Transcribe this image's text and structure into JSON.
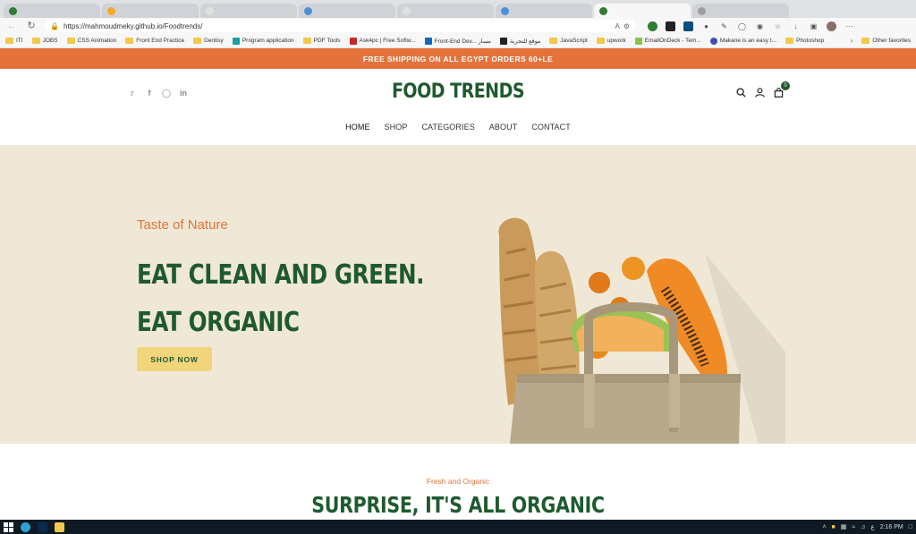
{
  "browser": {
    "tabs": [
      {
        "color": "#2e7d32"
      },
      {
        "color": "#f9a825"
      },
      {
        "color": "#e0e0e0"
      },
      {
        "color": "#4a90d9"
      },
      {
        "color": "#e0e0e0"
      },
      {
        "color": "#4a90d9"
      },
      {
        "color": "#2e7d32"
      },
      {
        "color": "#9e9e9e"
      }
    ],
    "url": "https://mahmoudmeky.github.io/Foodtrends/",
    "bookmarks": [
      {
        "label": "ITI",
        "kind": "folder"
      },
      {
        "label": "JOBS",
        "kind": "folder"
      },
      {
        "label": "CSS Animation",
        "kind": "folder"
      },
      {
        "label": "Front End Practice",
        "kind": "folder"
      },
      {
        "label": "Dentisy",
        "kind": "folder"
      },
      {
        "label": "Program application",
        "kind": "icon",
        "color": "#18a0a0"
      },
      {
        "label": "PDF Tools",
        "kind": "folder"
      },
      {
        "label": "Ask4pc | Free Softw...",
        "kind": "icon",
        "color": "#c62828"
      },
      {
        "label": "Front-End Dev... مسار",
        "kind": "icon",
        "color": "#1565c0"
      },
      {
        "label": "موقع للتجربة",
        "kind": "icon",
        "color": "#222222"
      },
      {
        "label": "JavaScript",
        "kind": "folder"
      },
      {
        "label": "upwork",
        "kind": "folder"
      },
      {
        "label": "EmailOnDeck - Tem...",
        "kind": "icon",
        "color": "#8bc34a"
      },
      {
        "label": "Makane is an easy t...",
        "kind": "icon",
        "color": "#3f51b5"
      },
      {
        "label": "Photoshop",
        "kind": "folder"
      }
    ],
    "other_favorites": "Other favorites"
  },
  "site": {
    "shipping_banner": "FREE SHIPPING ON ALL EGYPT ORDERS 60+LE",
    "logo": "FOOD TRENDS",
    "cart_count": "0",
    "nav": [
      "HOME",
      "SHOP",
      "CATEGORIES",
      "ABOUT",
      "CONTACT"
    ],
    "hero": {
      "tagline": "Taste of Nature",
      "title_line1": "EAT CLEAN AND GREEN.",
      "title_line2": "EAT ORGANIC",
      "cta": "SHOP NOW"
    },
    "intro": {
      "subtitle": "Fresh and Organic",
      "title": "SURPRISE, IT'S ALL ORGANIC"
    }
  },
  "taskbar": {
    "time": "2:16 PM",
    "lang": "ع"
  },
  "colors": {
    "accent_orange": "#e3733b",
    "brand_green": "#1f5a2f",
    "hero_bg": "#efe8d6",
    "button_yellow": "#f2d57b"
  }
}
